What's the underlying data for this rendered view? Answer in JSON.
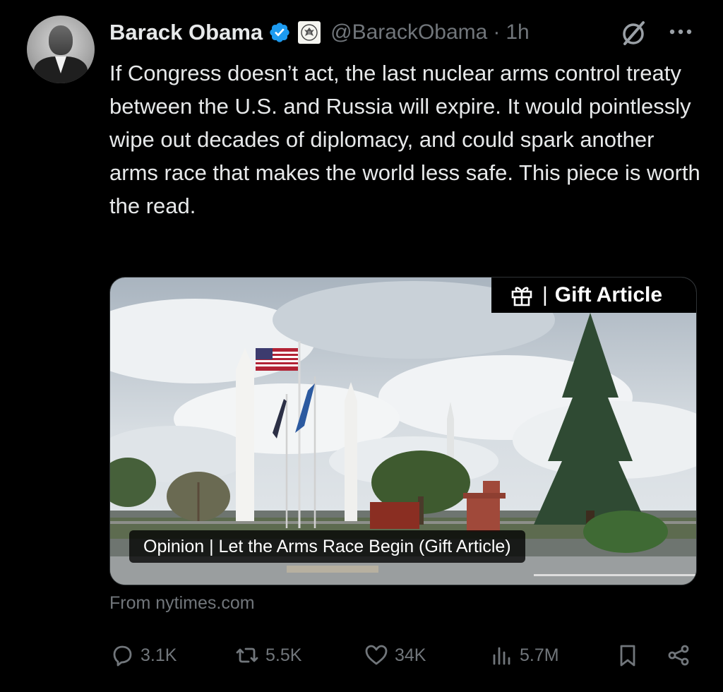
{
  "author": {
    "name": "Barack Obama",
    "handle": "@BarackObama",
    "separator": "·",
    "time": "1h"
  },
  "tweet_text": "If Congress doesn’t act, the last nuclear arms control treaty between the U.S. and Russia will expire. It would pointlessly wipe out decades of diplomacy, and could spark another arms race that makes the world less safe. This piece is worth the read.",
  "card": {
    "badge_label": "Gift Article",
    "badge_separator": "|",
    "caption": "Opinion | Let the Arms Race Begin (Gift Article)"
  },
  "source": "From nytimes.com",
  "actions": {
    "replies": "3.1K",
    "reposts": "5.5K",
    "likes": "34K",
    "views": "5.7M"
  },
  "icons": [
    "verified-badge-icon",
    "government-seal-icon",
    "grok-icon",
    "more-icon",
    "gift-icon",
    "reply-icon",
    "repost-icon",
    "like-icon",
    "views-icon",
    "bookmark-icon",
    "share-icon"
  ],
  "colors": {
    "background": "#000000",
    "text": "#e7e9ea",
    "muted": "#71767b",
    "verified": "#1d9bf0"
  }
}
